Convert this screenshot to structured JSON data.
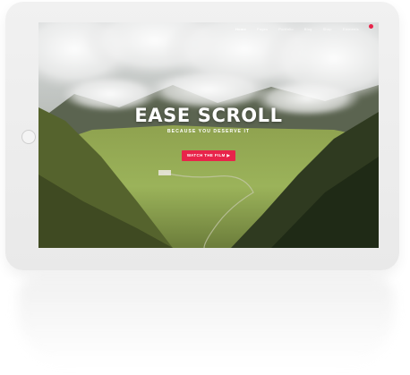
{
  "nav": {
    "items": [
      {
        "label": "Home",
        "active": true
      },
      {
        "label": "Pages",
        "active": false
      },
      {
        "label": "Portfolio",
        "active": false
      },
      {
        "label": "Blog",
        "active": false
      },
      {
        "label": "Shop",
        "active": false
      },
      {
        "label": "Elements",
        "active": false
      }
    ],
    "badge_color": "#e8244a"
  },
  "hero": {
    "title": "EASE SCROLL",
    "subtitle": "BECAUSE YOU DESERVE IT",
    "cta_label": "WATCH THE FILM ▶"
  },
  "colors": {
    "accent": "#e8244a",
    "device_frame": "#eeeeee"
  }
}
